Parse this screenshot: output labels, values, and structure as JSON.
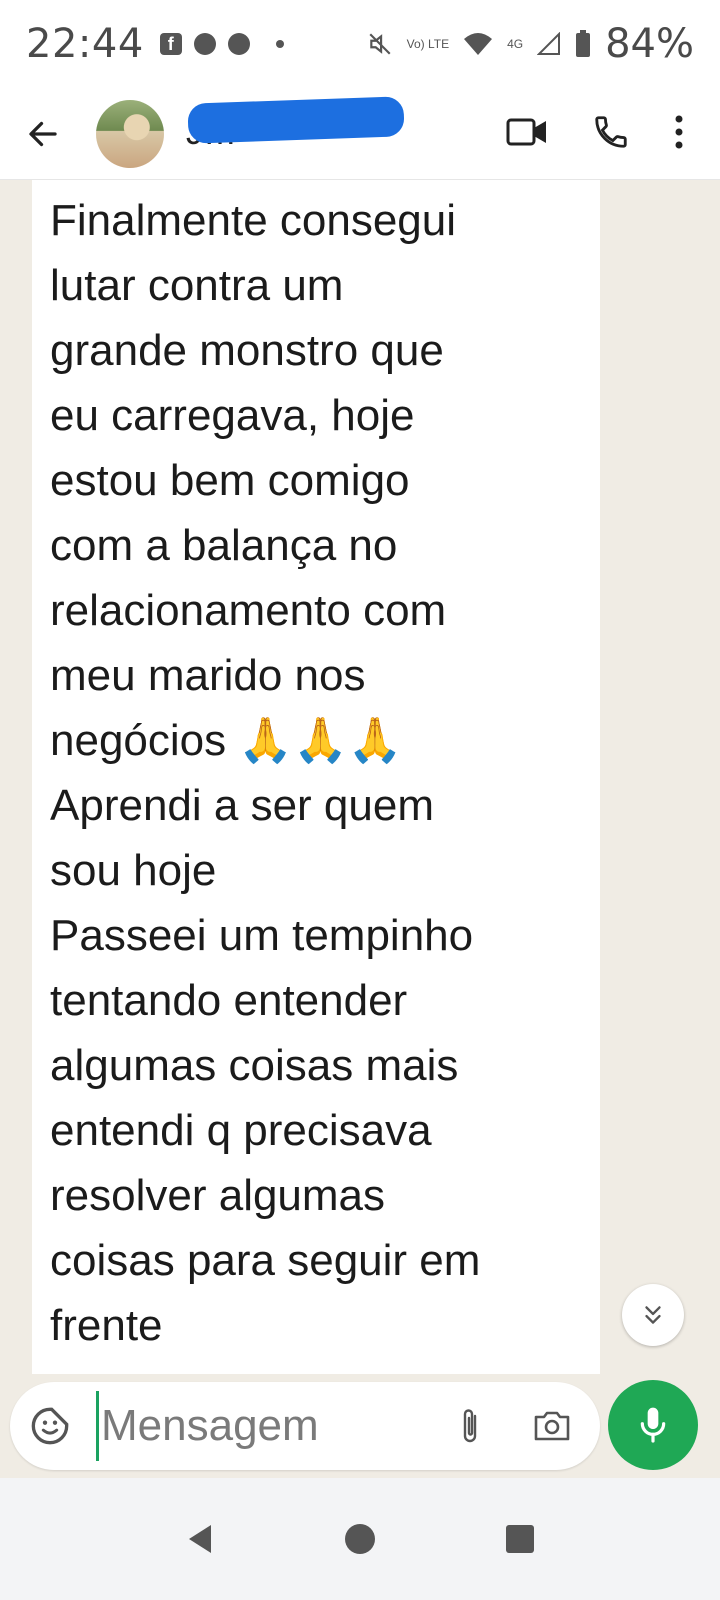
{
  "status_bar": {
    "time": "22:44",
    "battery": "84%",
    "network_label": "4G",
    "volte_label": "Vo) LTE"
  },
  "header": {
    "contact_name": "J…",
    "contact_name_redacted": true
  },
  "message": {
    "text_part1": "Finalmente consegui\nlutar contra um\ngrande monstro que\neu carregava, hoje\nestou bem comigo\ncom a balança no\nrelacionamento com\nmeu marido nos\nnegócios ",
    "emoji": "🙏🙏🙏",
    "text_part2": "\nAprendi a ser quem\nsou hoje\nPasseei um tempinho\ntentando entender\nalgumas coisas mais\nentendi q precisava\nresolver algumas\ncoisas para seguir em\nfrente"
  },
  "composer": {
    "placeholder": "Mensagem"
  },
  "colors": {
    "chat_background": "#f0ece4",
    "accent_green": "#1fa855",
    "cursor_green": "#1aa260",
    "redaction_blue": "#1d6fe0"
  },
  "icons": {
    "back": "arrow-left-icon",
    "video": "video-camera-icon",
    "call": "phone-icon",
    "menu": "more-vertical-icon",
    "emoji": "sticker-emoji-icon",
    "attach": "paperclip-icon",
    "camera": "camera-icon",
    "mic": "microphone-icon",
    "scroll": "double-chevron-down-icon",
    "nav_back": "triangle-back-icon",
    "nav_home": "circle-home-icon",
    "nav_recents": "square-recents-icon"
  }
}
